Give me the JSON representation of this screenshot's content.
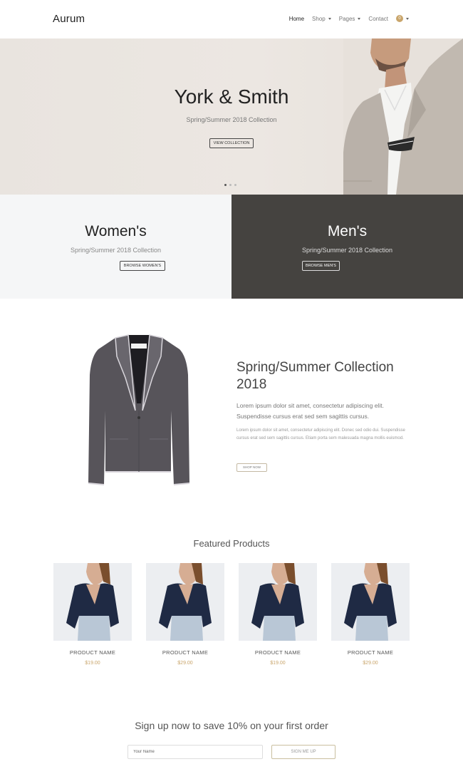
{
  "nav": {
    "logo": "Aurum",
    "items": [
      {
        "label": "Home",
        "active": true,
        "dropdown": false
      },
      {
        "label": "Shop",
        "active": false,
        "dropdown": true
      },
      {
        "label": "Pages",
        "active": false,
        "dropdown": true
      },
      {
        "label": "Contact",
        "active": false,
        "dropdown": false
      }
    ],
    "cart_count": "0"
  },
  "hero": {
    "title": "York & Smith",
    "subtitle": "Spring/Summer 2018 Collection",
    "button": "View Collection",
    "slides": 3,
    "active_slide": 0
  },
  "categories": {
    "women": {
      "title": "Women's",
      "subtitle": "Spring/Summer 2018 Collection",
      "button": "Browse Women's"
    },
    "men": {
      "title": "Men's",
      "subtitle": "Spring/Summer 2018 Collection",
      "button": "Browse Men's"
    }
  },
  "collection": {
    "title": "Spring/Summer Collection 2018",
    "lead": "Lorem ipsum dolor sit amet, consectetur adipiscing elit. Suspendisse cursus erat sed sem sagittis cursus.",
    "body": "Lorem ipsum dolor sit amet, consectetur adipiscing elit. Donec sed odio dui. Suspendisse cursus erat sed sem sagittis cursus. Etiam porta sem malesuada magna mollis euismod.",
    "button": "Shop Now"
  },
  "featured": {
    "title": "Featured Products",
    "products": [
      {
        "name": "PRODUCT NAME",
        "price": "$19.00"
      },
      {
        "name": "PRODUCT NAME",
        "price": "$29.00"
      },
      {
        "name": "PRODUCT NAME",
        "price": "$19.00"
      },
      {
        "name": "PRODUCT NAME",
        "price": "$29.00"
      }
    ]
  },
  "signup": {
    "title": "Sign up now to save 10% on your first order",
    "placeholder": "Your Name",
    "button": "Sign Me Up"
  },
  "colors": {
    "accent": "#c9a56b",
    "men_bg": "#454340",
    "women_bg": "#f5f6f7"
  }
}
